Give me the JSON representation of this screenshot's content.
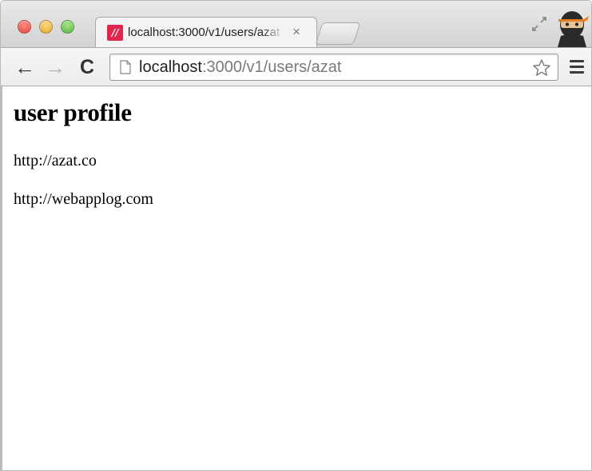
{
  "browser": {
    "tab": {
      "favicon_glyph": "//",
      "favicon_color": "#e0274b",
      "title": "localhost:3000/v1/users/azat",
      "close_glyph": "×"
    },
    "toolbar": {
      "back_glyph": "←",
      "forward_glyph": "→",
      "reload_glyph": "C"
    },
    "address": {
      "host": "localhost",
      "path": ":3000/v1/users/azat"
    },
    "icons": {
      "page": "page-icon",
      "bookmark": "star-icon",
      "menu": "hamburger-menu-icon",
      "fullscreen": "fullscreen-icon",
      "profile": "ninja-avatar"
    }
  },
  "page": {
    "heading": "user profile",
    "links": [
      "http://azat.co",
      "http://webapplog.com"
    ]
  }
}
